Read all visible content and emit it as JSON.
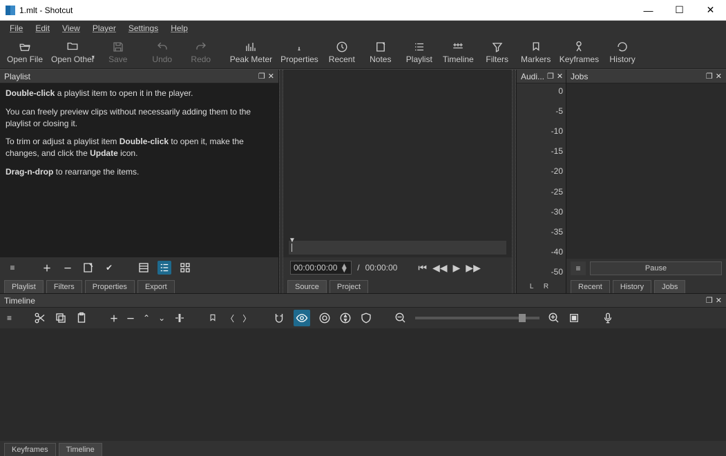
{
  "window": {
    "title": "1.mlt - Shotcut"
  },
  "menu": {
    "items": [
      "File",
      "Edit",
      "View",
      "Player",
      "Settings",
      "Help"
    ]
  },
  "toolbar": {
    "open_file": "Open File",
    "open_other": "Open Other",
    "save": "Save",
    "undo": "Undo",
    "redo": "Redo",
    "peak_meter": "Peak Meter",
    "properties": "Properties",
    "recent": "Recent",
    "notes": "Notes",
    "playlist": "Playlist",
    "timeline": "Timeline",
    "filters": "Filters",
    "markers": "Markers",
    "keyframes": "Keyframes",
    "history": "History"
  },
  "playlist": {
    "title": "Playlist",
    "help_l1a": "Double-click",
    "help_l1b": " a playlist item to open it in the player.",
    "help_l2": "You can freely preview clips without necessarily adding them to the playlist or closing it.",
    "help_l3a": "To trim or adjust a playlist item ",
    "help_l3b": "Double-click",
    "help_l3c": " to open it, make the changes, and click the ",
    "help_l3d": "Update",
    "help_l3e": " icon.",
    "help_l4a": "Drag-n-drop",
    "help_l4b": " to rearrange the items.",
    "tabs": {
      "playlist": "Playlist",
      "filters": "Filters",
      "properties": "Properties",
      "export": "Export"
    }
  },
  "player": {
    "current_tc": "00:00:00:00",
    "total_tc": "00:00:00",
    "sep": " / ",
    "tabs": {
      "source": "Source",
      "project": "Project"
    }
  },
  "audio": {
    "title": "Audi...",
    "labels": [
      "0",
      "-5",
      "-10",
      "-15",
      "-20",
      "-25",
      "-30",
      "-35",
      "-40",
      "-50"
    ],
    "lr": "L R"
  },
  "jobs": {
    "title": "Jobs",
    "pause": "Pause",
    "tabs": {
      "recent": "Recent",
      "history": "History",
      "jobs": "Jobs"
    }
  },
  "timeline": {
    "title": "Timeline",
    "tabs": {
      "keyframes": "Keyframes",
      "timeline": "Timeline"
    }
  }
}
